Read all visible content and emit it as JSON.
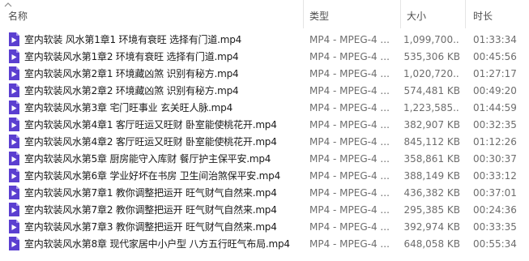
{
  "header": {
    "name_label": "名称",
    "type_label": "类型",
    "size_label": "大小",
    "duration_label": "时长"
  },
  "files": [
    {
      "name": "室内软装 风水第1章1 环境有衰旺 选择有门道.mp4",
      "type": "MP4 - MPEG-4 ...",
      "size": "1,099,700...",
      "duration": "01:33:34"
    },
    {
      "name": "室内软装风水第1章2 环境有衰旺 选择有门道.mp4",
      "type": "MP4 - MPEG-4 ...",
      "size": "535,306 KB",
      "duration": "00:45:56"
    },
    {
      "name": "室内软装风水第2章1 环境藏凶煞 识别有秘方.mp4",
      "type": "MP4 - MPEG-4 ...",
      "size": "1,020,720...",
      "duration": "01:27:17"
    },
    {
      "name": "室内软装风水第2章2 环境藏凶煞 识别有秘方.mp4",
      "type": "MP4 - MPEG-4 ...",
      "size": "574,481 KB",
      "duration": "00:49:20"
    },
    {
      "name": "室内软装风水第3章 宅门旺事业 玄关旺人脉.mp4",
      "type": "MP4 - MPEG-4 ...",
      "size": "1,223,585...",
      "duration": "01:44:59"
    },
    {
      "name": "室内软装风水第4章1 客厅旺运又旺财 卧室能使桃花开.mp4",
      "type": "MP4 - MPEG-4 ...",
      "size": "382,907 KB",
      "duration": "00:32:35"
    },
    {
      "name": "室内软装风水第4章2 客厅旺运又旺财 卧室能使桃花开.mp4",
      "type": "MP4 - MPEG-4 ...",
      "size": "845,112 KB",
      "duration": "01:12:26"
    },
    {
      "name": "室内软装风水第5章 厨房能守入库财 餐厅护主保平安.mp4",
      "type": "MP4 - MPEG-4 ...",
      "size": "358,861 KB",
      "duration": "00:30:37"
    },
    {
      "name": "室内软装风水第6章 学业好坏在书房 卫生间治煞保平安.mp4",
      "type": "MP4 - MPEG-4 ...",
      "size": "388,149 KB",
      "duration": "00:33:12"
    },
    {
      "name": "室内软装风水第7章1 教你调整把运开  旺气财气自然来.mp4",
      "type": "MP4 - MPEG-4 ...",
      "size": "436,382 KB",
      "duration": "00:37:01"
    },
    {
      "name": "室内软装风水第7章2 教你调整把运开  旺气财气自然来.mp4",
      "type": "MP4 - MPEG-4 ...",
      "size": "295,385 KB",
      "duration": "00:24:36"
    },
    {
      "name": "室内软装风水第7章3 教你调整把运开  旺气财气自然来.mp4",
      "type": "MP4 - MPEG-4 ...",
      "size": "392,974 KB",
      "duration": "00:33:35"
    },
    {
      "name": "室内软装风水第8章 现代家居中小户型  八方五行旺气布局.mp4",
      "type": "MP4 - MPEG-4 ...",
      "size": "648,058 KB",
      "duration": "00:55:34"
    }
  ],
  "icons": {
    "file": "mp4-video-file-icon",
    "sort": "sort-ascending-icon"
  },
  "colors": {
    "icon_purple": "#5b3fd0",
    "header_text": "#4d4d4d",
    "detail_text": "#6d6d6d",
    "name_text": "#1a1a1a"
  }
}
